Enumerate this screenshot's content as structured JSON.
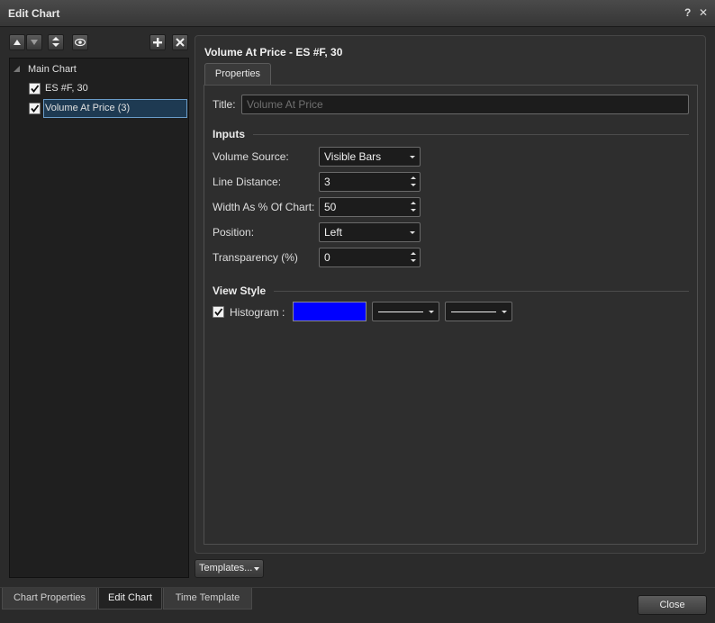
{
  "window": {
    "title": "Edit Chart",
    "help_label": "?",
    "close_label": "✕"
  },
  "tree": {
    "root_label": "Main Chart",
    "items": [
      {
        "label": "ES #F, 30",
        "checked": true
      },
      {
        "label": "Volume At Price (3)",
        "checked": true,
        "selected": true
      }
    ]
  },
  "left_toolbar": {
    "icons": [
      "arrow-up-icon",
      "arrow-down-icon",
      "expand-collapse-icon",
      "eye-icon",
      "plus-icon",
      "delete-icon"
    ]
  },
  "panel": {
    "heading": "Volume At Price - ES #F, 30",
    "tab_label": "Properties",
    "title_label": "Title:",
    "title_placeholder": "Volume At Price",
    "inputs_section": "Inputs",
    "volume_source_label": "Volume Source:",
    "volume_source_value": "Visible Bars",
    "line_distance_label": "Line Distance:",
    "line_distance_value": "3",
    "width_pct_label": "Width As % Of Chart:",
    "width_pct_value": "50",
    "position_label": "Position:",
    "position_value": "Left",
    "transparency_label": "Transparency (%)",
    "transparency_value": "0",
    "view_style_section": "View Style",
    "histogram_label": "Histogram :",
    "histogram_checked": true,
    "histogram_color": "#0000ff"
  },
  "templates_button": "Templates...",
  "bottom_tabs": [
    {
      "label": "Chart Properties",
      "active": false
    },
    {
      "label": "Edit Chart",
      "active": true
    },
    {
      "label": "Time Template",
      "active": false
    }
  ],
  "close_button": "Close",
  "colors": {
    "background": "#2b2b2b",
    "selection": "#1e3a52",
    "accent_blue": "#0000ff"
  }
}
